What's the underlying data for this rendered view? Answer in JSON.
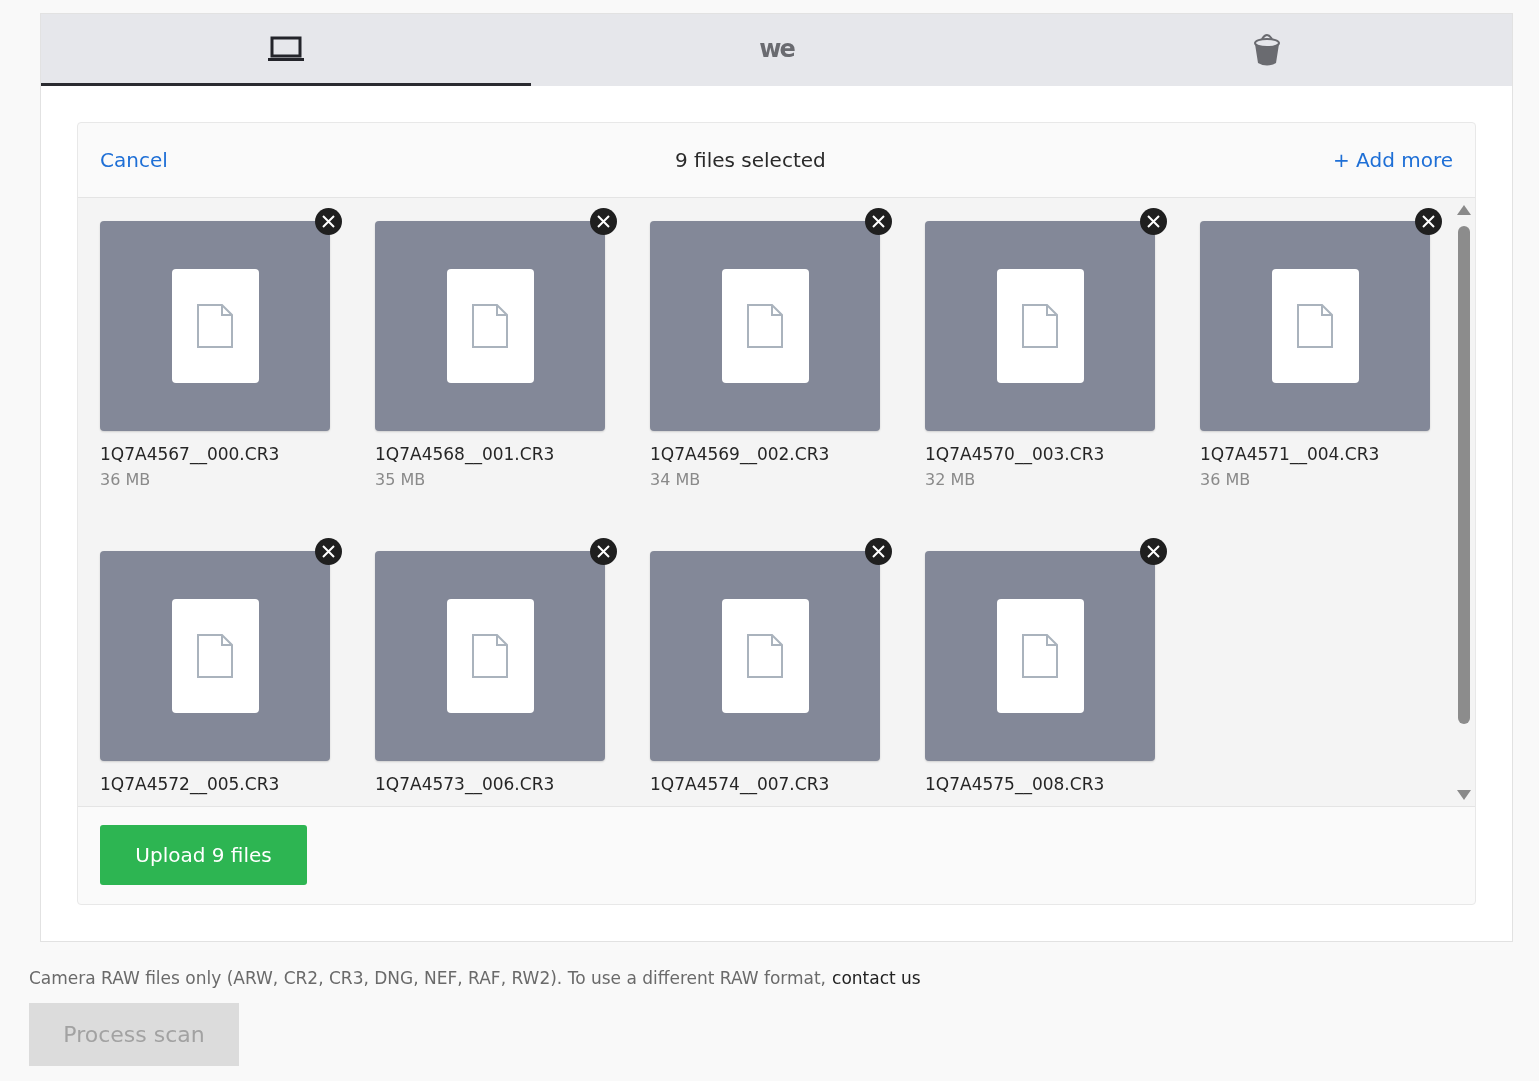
{
  "tabs": [
    {
      "kind": "laptop",
      "selected": true
    },
    {
      "kind": "logo",
      "label": "we",
      "selected": false
    },
    {
      "kind": "bucket",
      "selected": false
    }
  ],
  "uploader": {
    "cancel": "Cancel",
    "title": "9 files selected",
    "add_more": "+ Add more",
    "files": [
      {
        "name": "1Q7A4567__000.CR3",
        "size": "36 MB"
      },
      {
        "name": "1Q7A4568__001.CR3",
        "size": "35 MB"
      },
      {
        "name": "1Q7A4569__002.CR3",
        "size": "34 MB"
      },
      {
        "name": "1Q7A4570__003.CR3",
        "size": "32 MB"
      },
      {
        "name": "1Q7A4571__004.CR3",
        "size": "36 MB"
      },
      {
        "name": "1Q7A4572__005.CR3"
      },
      {
        "name": "1Q7A4573__006.CR3"
      },
      {
        "name": "1Q7A4574__007.CR3"
      },
      {
        "name": "1Q7A4575__008.CR3"
      }
    ],
    "upload_button": "Upload 9 files"
  },
  "note": {
    "text": "Camera RAW files only (ARW, CR2, CR3, DNG, NEF, RAF, RW2). To use a different RAW format,",
    "link": "contact us"
  },
  "process_button": {
    "label": "Process scan",
    "disabled": true
  }
}
